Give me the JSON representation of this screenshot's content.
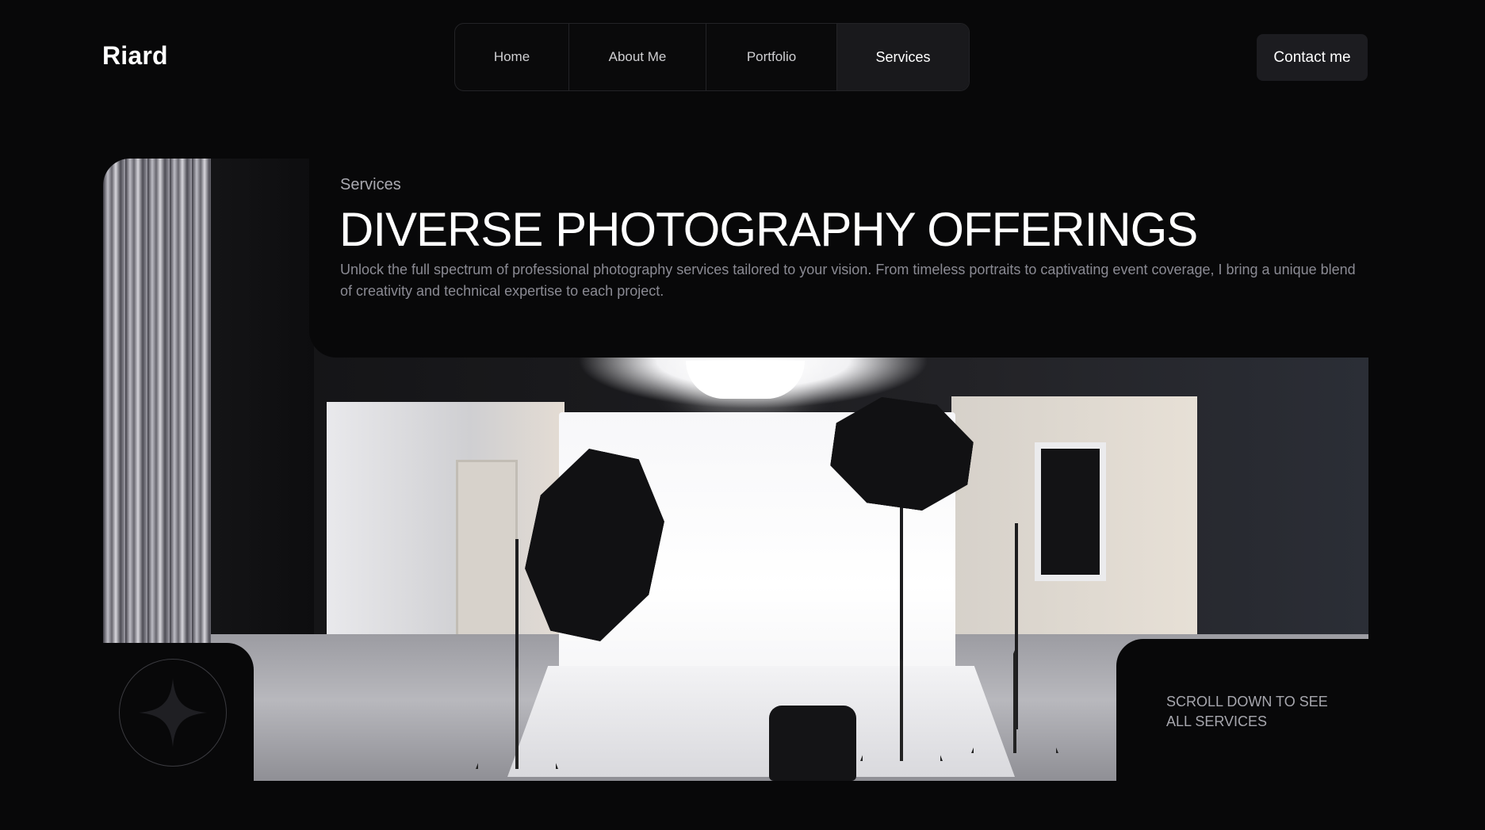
{
  "header": {
    "brand": "Riard",
    "nav": [
      {
        "label": "Home",
        "active": false
      },
      {
        "label": "About Me",
        "active": false
      },
      {
        "label": "Portfolio",
        "active": false
      },
      {
        "label": "Services",
        "active": true
      }
    ],
    "contact_label": "Contact me"
  },
  "hero": {
    "eyebrow": "Services",
    "headline": "DIVERSE PHOTOGRAPHY OFFERINGS",
    "description": "Unlock the full spectrum of professional photography services tailored to your vision. From timeless portraits to captivating event coverage, I bring a unique blend of creativity and technical expertise to each project.",
    "scroll_hint": "SCROLL DOWN TO SEE ALL SERVICES",
    "badge_icon": "four-point-star-icon"
  },
  "colors": {
    "background": "#080809",
    "accent_button": "#1c1c20",
    "muted_text": "#8a8a93"
  }
}
